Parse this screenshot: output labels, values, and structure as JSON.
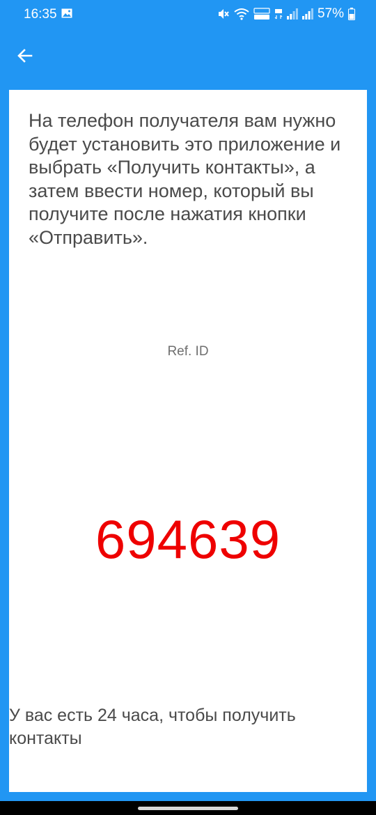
{
  "status_bar": {
    "time": "16:35",
    "battery": "57%",
    "network_icons": [
      "mute-icon",
      "wifi-icon",
      "volte-lte-icon",
      "4g-icon",
      "signal-icon",
      "signal-icon",
      "battery-icon"
    ]
  },
  "app_bar": {
    "back_icon": "arrow-left-icon"
  },
  "content": {
    "instructions": "На телефон получателя вам нужно будет установить это приложение и выбрать «Получить контакты», а затем ввести номер, который вы получите после нажатия кнопки «Отправить».",
    "ref_label": "Ref. ID",
    "ref_code": "694639",
    "footer_note": "У вас есть 24 часа, чтобы получить контакты"
  },
  "colors": {
    "primary": "#2196f3",
    "code": "#ee0000",
    "text": "#4a4a4a"
  }
}
